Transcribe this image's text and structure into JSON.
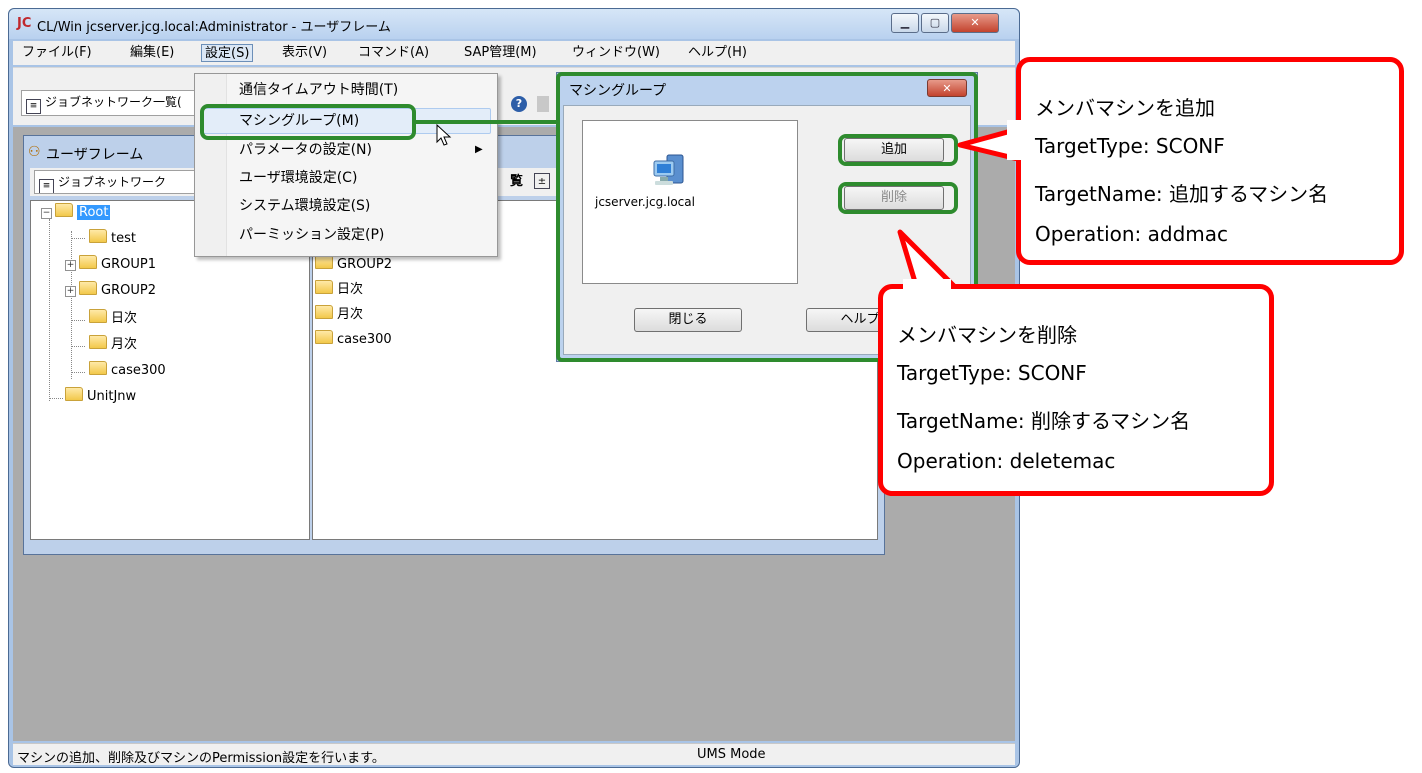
{
  "window": {
    "logo": "JC",
    "title": "CL/Win jcserver.jcg.local:Administrator - ユーザフレーム"
  },
  "menubar": [
    "ファイル(F)",
    "編集(E)",
    "設定(S)",
    "表示(V)",
    "コマンド(A)",
    "SAP管理(M)",
    "ウィンドウ(W)",
    "ヘルプ(H)"
  ],
  "toolbar": {
    "combo": "ジョブネットワーク一覧("
  },
  "child": {
    "title": "ユーザフレーム",
    "combo": "ジョブネットワーク",
    "list_btn": "覧"
  },
  "tree": {
    "root": "Root",
    "items": [
      "test",
      "GROUP1",
      "GROUP2",
      "日次",
      "月次",
      "case300"
    ],
    "other": "UnitJnw"
  },
  "list": [
    "GROUP2",
    "日次",
    "月次",
    "case300"
  ],
  "settings_menu": {
    "items": [
      "通信タイムアウト時間(T)",
      "マシングループ(M)",
      "パラメータの設定(N)",
      "ユーザ環境設定(C)",
      "システム環境設定(S)",
      "パーミッション設定(P)"
    ]
  },
  "dialog": {
    "title": "マシングループ",
    "machine": "jcserver.jcg.local",
    "add": "追加",
    "delete": "削除",
    "close": "閉じる",
    "help": "ヘルプ"
  },
  "status": {
    "message": "マシンの追加、削除及びマシンのPermission設定を行います。",
    "mode": "UMS Mode"
  },
  "callout_add": {
    "line1": "メンバマシンを追加",
    "line2": "TargetType: SCONF",
    "line3": "TargetName: 追加するマシン名",
    "line4": "Operation: addmac"
  },
  "callout_delete": {
    "line1": "メンバマシンを削除",
    "line2": "TargetType: SCONF",
    "line3": "TargetName: 削除するマシン名",
    "line4": "Operation: deletemac"
  },
  "colors": {
    "highlight": "#2e8b2e",
    "callout": "#ff0000",
    "selection": "#3399ff"
  }
}
